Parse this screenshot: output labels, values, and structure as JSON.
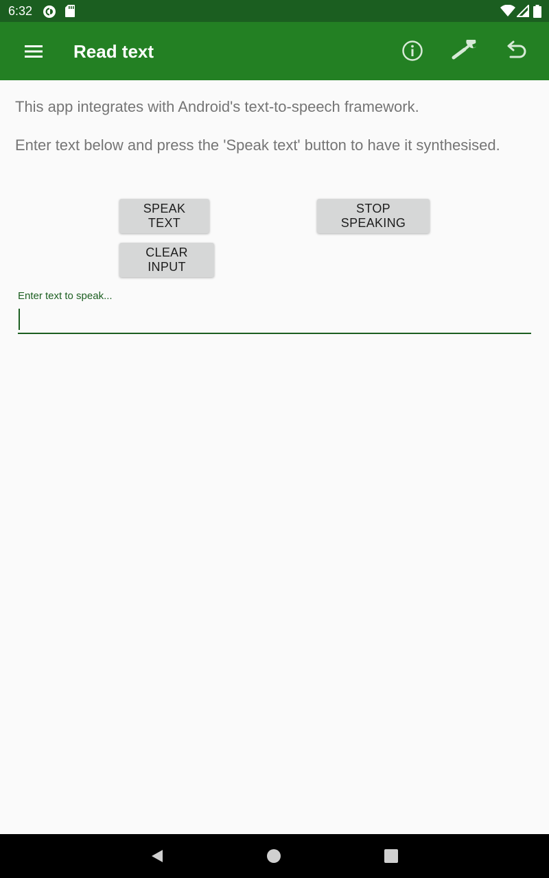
{
  "status_bar": {
    "time": "6:32",
    "icons": [
      "pocket-casts-icon",
      "sd-card-icon",
      "wifi-icon",
      "cellular-signal-icon",
      "battery-icon"
    ]
  },
  "app_bar": {
    "title": "Read text",
    "background": "#238023",
    "actions": [
      "menu-icon",
      "info-icon",
      "wrench-icon",
      "undo-icon"
    ]
  },
  "content": {
    "intro_line_1": "This app integrates with Android's text-to-speech framework.",
    "intro_line_2": "Enter text below and press the 'Speak text' button to have it synthesised.",
    "buttons": {
      "speak": "SPEAK TEXT",
      "stop": "STOP SPEAKING",
      "clear": "CLEAR INPUT"
    },
    "input": {
      "label": "Enter text to speak...",
      "value": ""
    }
  },
  "nav_bar": {
    "icons": [
      "back-icon",
      "home-icon",
      "recents-icon"
    ]
  }
}
